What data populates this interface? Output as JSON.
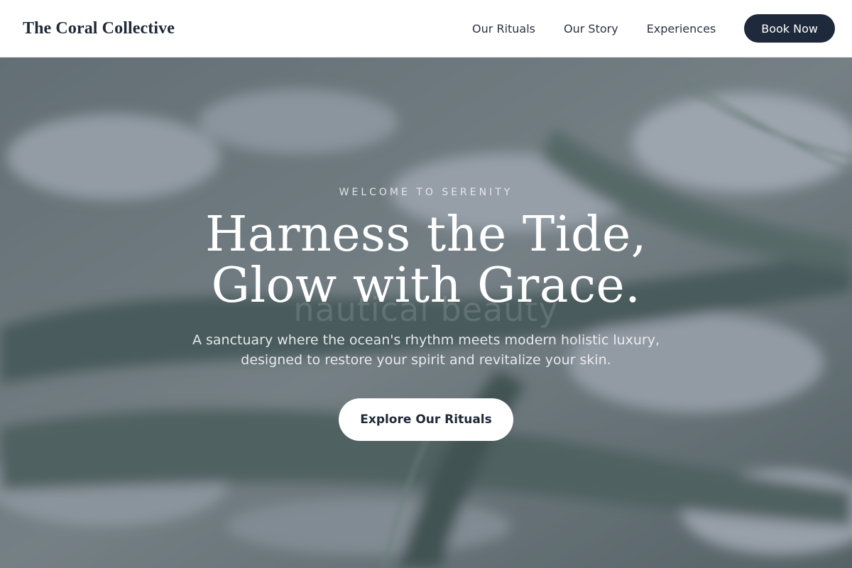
{
  "header": {
    "brand": "The Coral Collective",
    "nav": [
      "Our Rituals",
      "Our Story",
      "Experiences"
    ],
    "book_label": "Book Now"
  },
  "hero": {
    "eyebrow": "WELCOME TO SERENITY",
    "headline_line1": "Harness the Tide,",
    "headline_line2": "Glow with Grace.",
    "ghost_text": "nautical beauty",
    "subtext_line1": "A sanctuary where the ocean's rhythm meets modern holistic luxury,",
    "subtext_line2": "designed to restore your spirit and revitalize your skin.",
    "cta_label": "Explore Our Rituals",
    "background": "blurred-palm-leaves-photo"
  },
  "colors": {
    "nav_bg": "#ffffff",
    "book_button_bg": "#1e293b",
    "brand_text": "#1f2937",
    "hero_overlay": "#464e66"
  }
}
